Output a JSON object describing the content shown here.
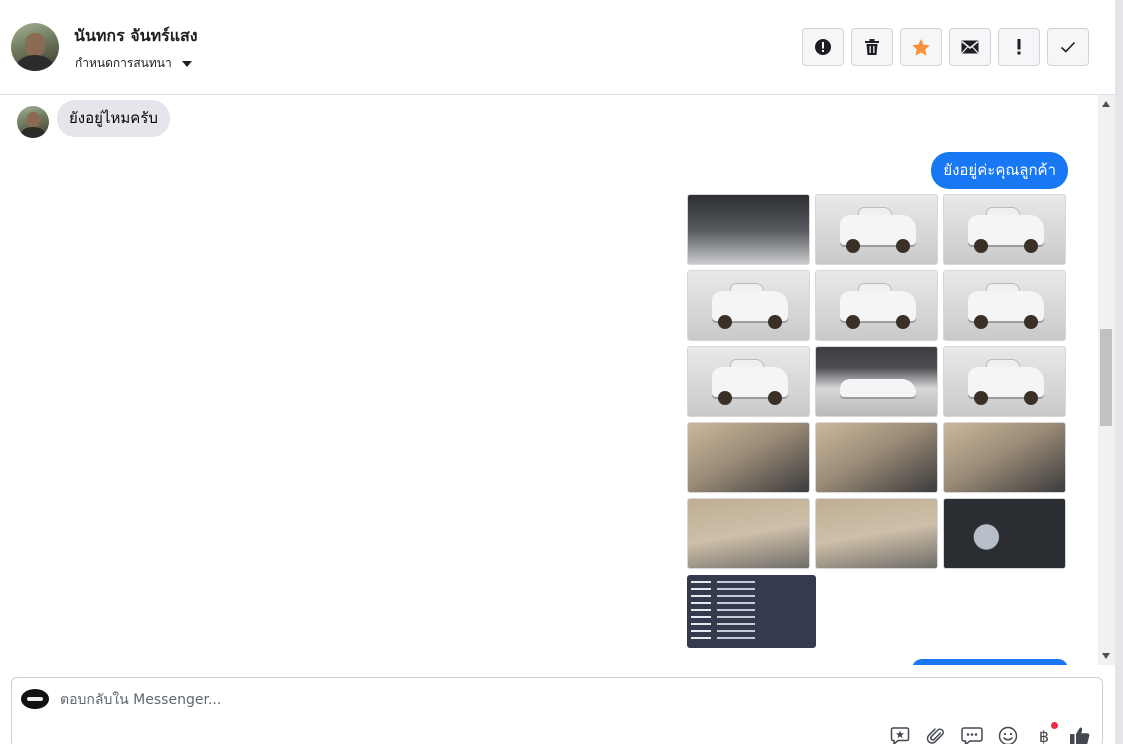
{
  "header": {
    "contact_name": "นันทกร จันทร์แสง",
    "status_label": "กำหนดการสนทนา",
    "actions": [
      {
        "name": "report-icon",
        "label": "!"
      },
      {
        "name": "trash-icon",
        "label": ""
      },
      {
        "name": "star-icon",
        "label": ""
      },
      {
        "name": "envelope-icon",
        "label": ""
      },
      {
        "name": "exclamation-icon",
        "label": "!"
      },
      {
        "name": "checkmark-icon",
        "label": ""
      }
    ],
    "star_color": "#f7923b"
  },
  "messages": {
    "incoming_1": "ยังอยู่ไหมครับ",
    "outgoing_1": "ยังอยู่ค่ะคุณลูกค้า"
  },
  "photos": [
    {
      "kind": "engine"
    },
    {
      "kind": "car"
    },
    {
      "kind": "car"
    },
    {
      "kind": "car"
    },
    {
      "kind": "car"
    },
    {
      "kind": "car"
    },
    {
      "kind": "car"
    },
    {
      "kind": "side"
    },
    {
      "kind": "car"
    },
    {
      "kind": "interior"
    },
    {
      "kind": "interior"
    },
    {
      "kind": "interior"
    },
    {
      "kind": "seat"
    },
    {
      "kind": "seat"
    },
    {
      "kind": "dash"
    }
  ],
  "composer": {
    "placeholder": "ตอบกลับใน Messenger...",
    "tools": [
      "sticker-icon",
      "paperclip-icon",
      "saved-replies-icon",
      "emoji-icon",
      "baht-icon",
      "thumbs-up-icon"
    ],
    "baht_symbol": "฿"
  },
  "colors": {
    "outgoing_bubble": "#1877f2",
    "incoming_bubble": "#e4e6eb",
    "notification_dot": "#f02849"
  }
}
